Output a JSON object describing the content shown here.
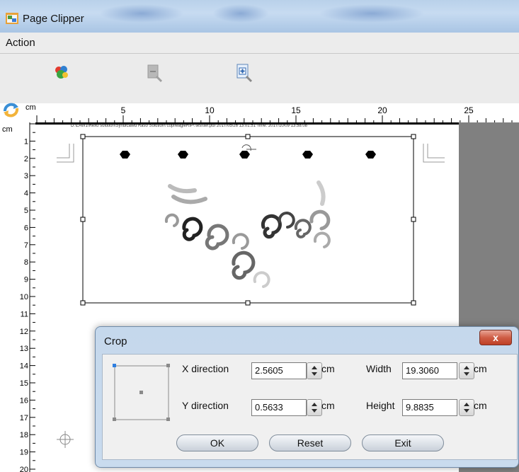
{
  "window": {
    "title": "Page Clipper"
  },
  "menu": {
    "items": [
      "Action"
    ]
  },
  "toolbar": {
    "buttons": [
      {
        "name": "colorful-tool-icon"
      },
      {
        "name": "zoom-out-icon",
        "state": "disabled"
      },
      {
        "name": "zoom-in-icon"
      }
    ]
  },
  "ruler": {
    "unit": "cm",
    "horizontal_labels": [
      "5",
      "10",
      "15",
      "20",
      "25"
    ],
    "vertical_labels": [
      "1",
      "2",
      "3",
      "4",
      "5",
      "6",
      "7",
      "8",
      "9",
      "10",
      "11",
      "12",
      "13",
      "14",
      "15",
      "16",
      "17",
      "18",
      "19",
      "20"
    ]
  },
  "document": {
    "file_path": "D:\\LAW1\\Rexo solution\\Syndicated Raso Solution\\ copi\\eagleRIP\\ test\\ter.pdf 2017/05/26 13:01:51 Time: 2017/10/09 13:58:08"
  },
  "crop_dialog": {
    "title": "Crop",
    "close_label": "x",
    "x_direction": {
      "label": "X direction",
      "value": "2.5605",
      "unit": "cm"
    },
    "y_direction": {
      "label": "Y direction",
      "value": "0.5633",
      "unit": "cm"
    },
    "width": {
      "label": "Width",
      "value": "19.3060",
      "unit": "cm"
    },
    "height": {
      "label": "Height",
      "value": "9.8835",
      "unit": "cm"
    },
    "buttons": {
      "ok": "OK",
      "reset": "Reset",
      "exit": "Exit"
    }
  },
  "colors": {
    "title_bar": "#b9d1ea",
    "dialog_bg": "#c9dbee",
    "close_red": "#c9472f",
    "workspace_gray": "#808080"
  }
}
